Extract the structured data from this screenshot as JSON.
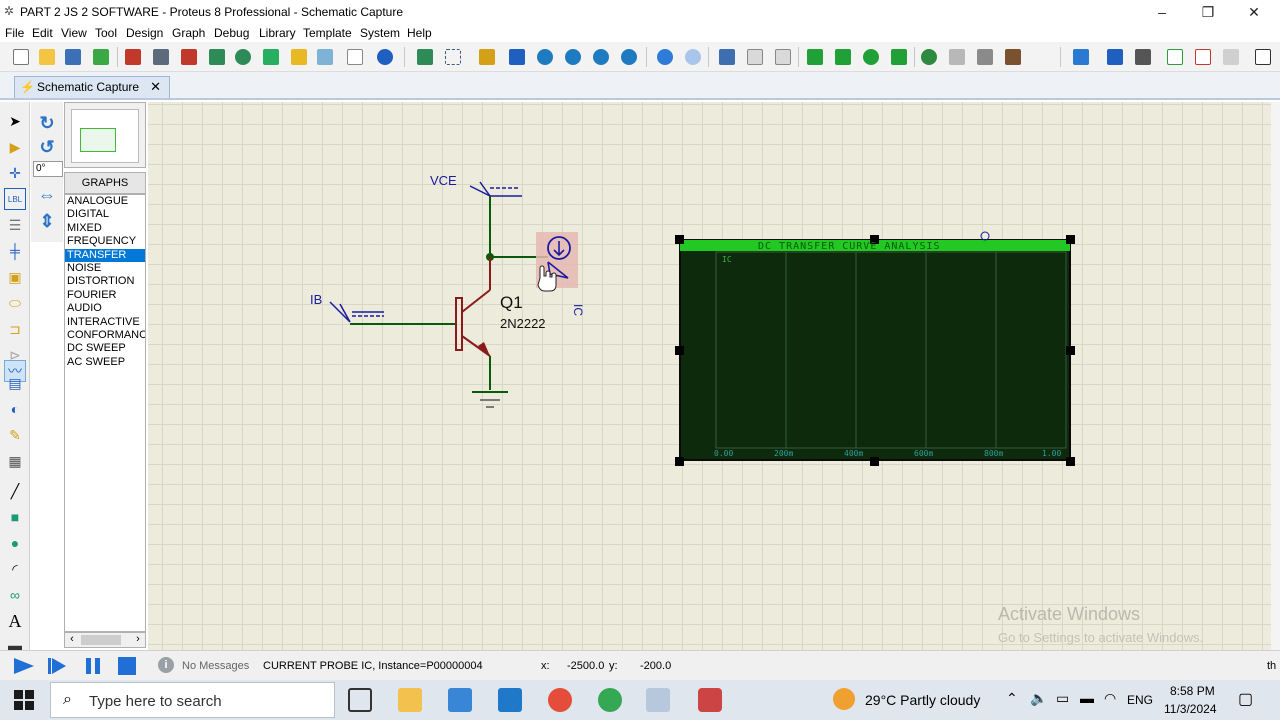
{
  "window": {
    "title": "PART 2 JS 2 SOFTWARE - Proteus 8 Professional - Schematic Capture",
    "minimize": "–",
    "maximize": "❐",
    "close": "✕"
  },
  "menu": [
    "File",
    "Edit",
    "View",
    "Tool",
    "Design",
    "Graph",
    "Debug",
    "Library",
    "Template",
    "System",
    "Help"
  ],
  "tab": {
    "label": "Schematic Capture",
    "close": "✕"
  },
  "rotation_field": "0°",
  "graphs_panel": {
    "header": "GRAPHS",
    "items": [
      "ANALOGUE",
      "DIGITAL",
      "MIXED",
      "FREQUENCY",
      "TRANSFER",
      "NOISE",
      "DISTORTION",
      "FOURIER",
      "AUDIO",
      "INTERACTIVE",
      "CONFORMANCE",
      "DC SWEEP",
      "AC SWEEP"
    ],
    "selected": "TRANSFER"
  },
  "schematic": {
    "vce_label": "VCE",
    "ib_label": "IB",
    "transistor_ref": "Q1",
    "transistor_part": "2N2222",
    "probe_label": "IC",
    "graph": {
      "title": "DC TRANSFER CURVE ANALYSIS",
      "trace_label": "IC",
      "x_ticks": [
        "0.00",
        "200m",
        "400m",
        "600m",
        "800m",
        "1.00"
      ]
    }
  },
  "status": {
    "messages": "No Messages",
    "info": "CURRENT PROBE IC, Instance=P00000004",
    "x_label": "x:",
    "x_value": "-2500.0",
    "y_label": "y:",
    "y_value": "-200.0",
    "right_tag": "th"
  },
  "watermark": {
    "line1": "Activate Windows",
    "line2": "Go to Settings to activate Windows."
  },
  "taskbar": {
    "search_placeholder": "Type here to search",
    "weather": "29°C  Partly cloudy",
    "language": "ENG",
    "time": "8:58 PM",
    "date": "11/3/2024"
  },
  "colors": {
    "graph_bg": "#0d2a0d",
    "graph_title_bar": "#22c922",
    "wire": "#0b5a0b",
    "transistor": "#8b1a1a",
    "label_blue": "#1a1a9c",
    "selection": "#0078d7"
  }
}
